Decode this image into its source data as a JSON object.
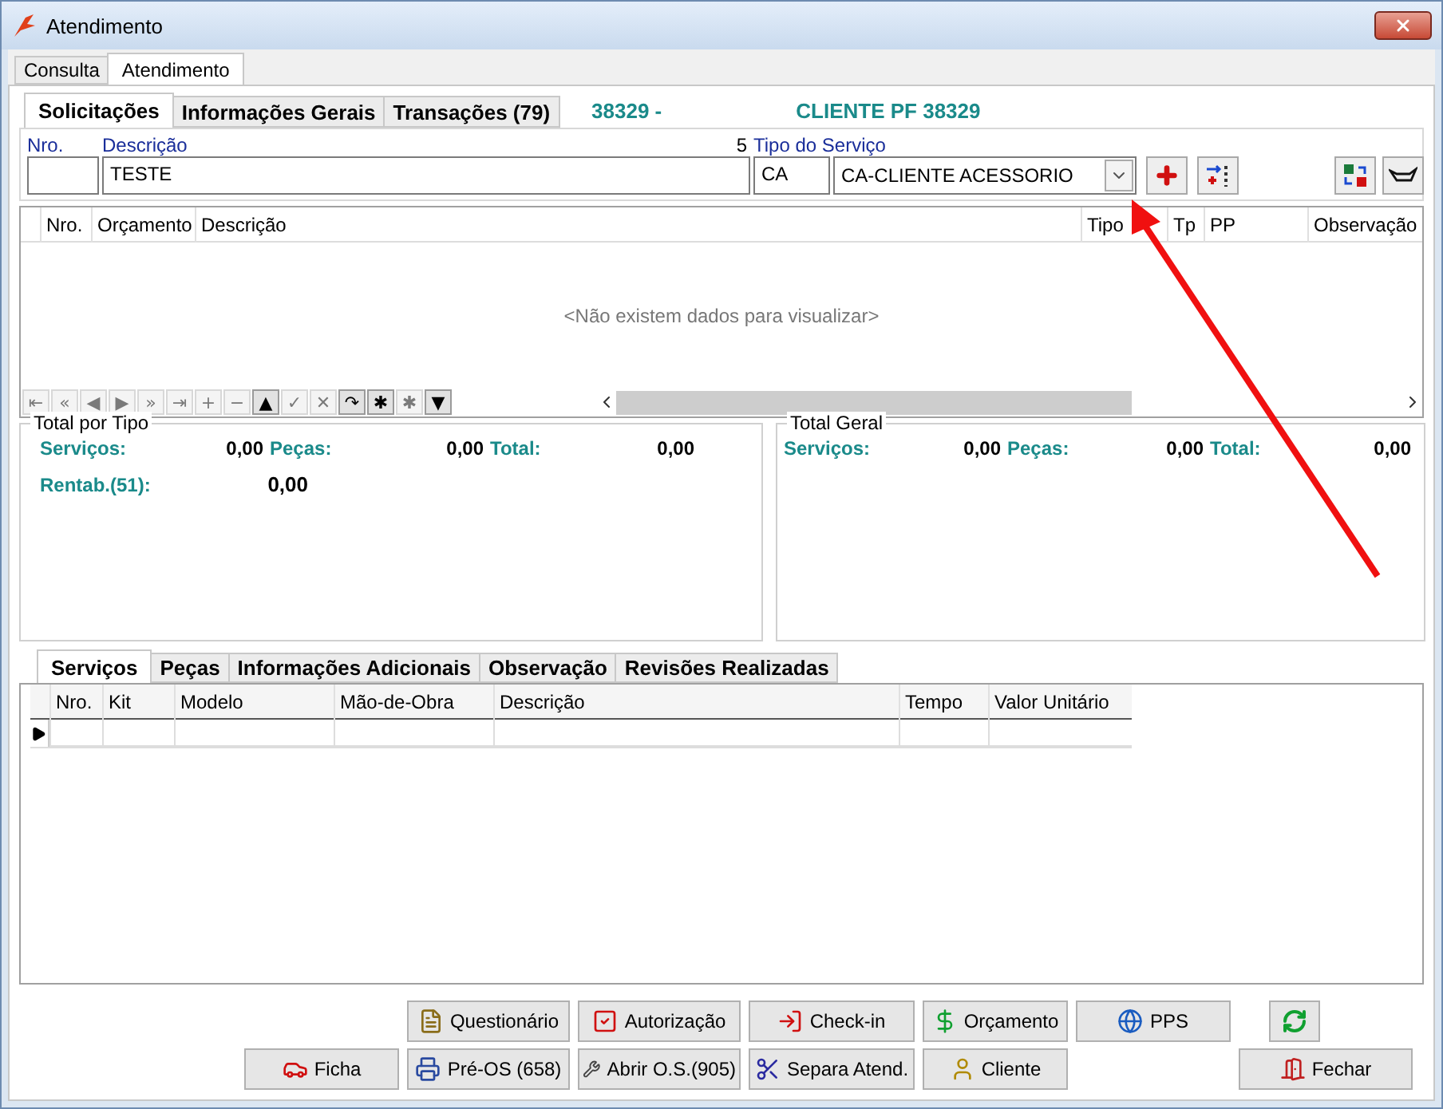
{
  "window": {
    "title": "Atendimento"
  },
  "outer_tabs": [
    {
      "label": "Consulta",
      "selected": false
    },
    {
      "label": "Atendimento",
      "selected": true
    }
  ],
  "inner_tabs": [
    {
      "label": "Solicitações",
      "selected": true
    },
    {
      "label": "Informações Gerais",
      "selected": false
    },
    {
      "label": "Transações (79)",
      "selected": false
    }
  ],
  "header_info": [
    "38329 -",
    "CLIENTE PF 38329"
  ],
  "form": {
    "nro_label": "Nro.",
    "descricao_label": "Descrição",
    "count": "5",
    "tipo_label": "Tipo do Serviço",
    "descricao_value": "TESTE",
    "tipo_code": "CA",
    "tipo_value": "CA-CLIENTE ACESSORIO"
  },
  "requests_table": {
    "columns": [
      "Nro.",
      "Orçamento",
      "Descrição",
      "Tipo",
      "Tp",
      "PP",
      "Observação"
    ],
    "empty_message": "<Não existem dados para visualizar>"
  },
  "navigator": [
    {
      "glyph": "⇤",
      "disabled": true
    },
    {
      "glyph": "«",
      "disabled": true
    },
    {
      "glyph": "◀",
      "disabled": true
    },
    {
      "glyph": "▶",
      "disabled": true
    },
    {
      "glyph": "»",
      "disabled": true
    },
    {
      "glyph": "⇥",
      "disabled": true
    },
    {
      "glyph": "+",
      "disabled": true
    },
    {
      "glyph": "−",
      "disabled": true
    },
    {
      "glyph": "▲",
      "disabled": false
    },
    {
      "glyph": "✓",
      "disabled": true
    },
    {
      "glyph": "✕",
      "disabled": true
    },
    {
      "glyph": "↷",
      "disabled": false
    },
    {
      "glyph": "✱",
      "disabled": false
    },
    {
      "glyph": "✱",
      "disabled": true
    },
    {
      "glyph": "▼",
      "disabled": false
    }
  ],
  "totals": [
    {
      "title": "Total por Tipo",
      "items": [
        {
          "label": "Serviços:",
          "value": "0,00"
        },
        {
          "label": "Peças:",
          "value": "0,00"
        },
        {
          "label": "Total:",
          "value": "0,00"
        }
      ],
      "rentab": {
        "label": "Rentab.(51):",
        "value": "0,00"
      }
    },
    {
      "title": "Total Geral",
      "items": [
        {
          "label": "Serviços:",
          "value": "0,00"
        },
        {
          "label": "Peças:",
          "value": "0,00"
        },
        {
          "label": "Total:",
          "value": "0,00"
        }
      ]
    }
  ],
  "bottom_tabs": [
    {
      "label": "Serviços",
      "selected": true
    },
    {
      "label": "Peças",
      "selected": false
    },
    {
      "label": "Informações Adicionais",
      "selected": false
    },
    {
      "label": "Observação",
      "selected": false
    },
    {
      "label": "Revisões Realizadas",
      "selected": false
    }
  ],
  "services_table": {
    "columns": [
      "Nro.",
      "Kit",
      "Modelo",
      "Mão-de-Obra",
      "Descrição",
      "Tempo",
      "Valor Unitário"
    ]
  },
  "buttons_row1": [
    {
      "label": "Questionário",
      "kind": "form"
    },
    {
      "label": "Autorização",
      "kind": "check"
    },
    {
      "label": "Check-in",
      "kind": "checkin"
    },
    {
      "label": "Orçamento",
      "kind": "money"
    },
    {
      "label": "PPS",
      "kind": "globe"
    }
  ],
  "buttons_row2": [
    {
      "label": "Ficha",
      "kind": "car"
    },
    {
      "label": "Pré-OS (658)",
      "kind": "print"
    },
    {
      "label": "Abrir O.S.(905)",
      "kind": "tools"
    },
    {
      "label": "Separa Atend.",
      "kind": "split"
    },
    {
      "label": "Cliente",
      "kind": "person"
    },
    {
      "label": "Fechar",
      "kind": "exit"
    }
  ]
}
